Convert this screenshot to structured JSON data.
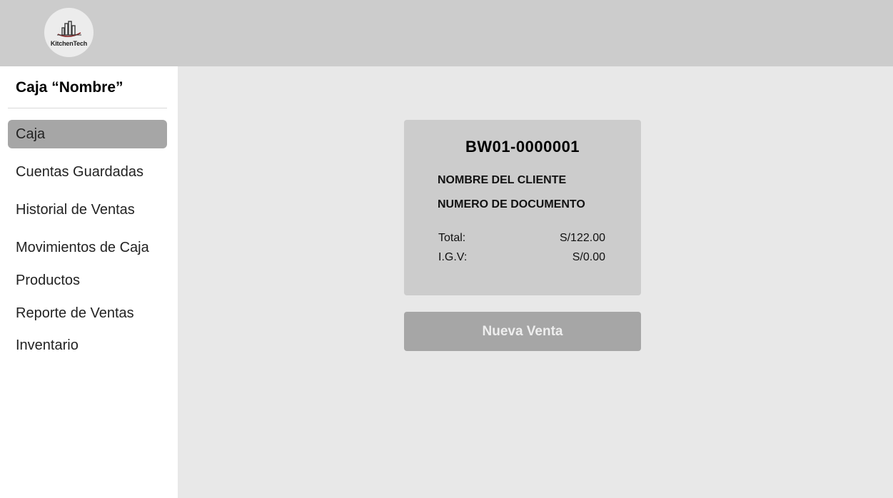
{
  "header": {
    "logo_text": "KitchenTech",
    "logo_icon": "city-skyline-icon"
  },
  "sidebar": {
    "title": "Caja “Nombre”",
    "items": [
      {
        "label": "Caja",
        "active": true
      },
      {
        "label": "Cuentas Guardadas",
        "active": false
      },
      {
        "label": "Historial de Ventas",
        "active": false
      },
      {
        "label": "Movimientos de Caja",
        "active": false
      },
      {
        "label": "Productos",
        "active": false
      },
      {
        "label": "Reporte de Ventas",
        "active": false
      },
      {
        "label": "Inventario",
        "active": false
      }
    ]
  },
  "receipt": {
    "doc_number": "BW01-0000001",
    "client_name": "NOMBRE DEL CLIENTE",
    "document_id": "NUMERO DE DOCUMENTO",
    "total_label": "Total:",
    "total_value": "S/122.00",
    "igv_label": "I.G.V:",
    "igv_value": "S/0.00"
  },
  "actions": {
    "new_sale_label": "Nueva Venta"
  },
  "colors": {
    "topbar": "#cccccc",
    "main_bg": "#e8e8e8",
    "card_bg": "#cccccc",
    "active_item": "#a6a6a6",
    "button_bg": "#a6a6a6"
  }
}
